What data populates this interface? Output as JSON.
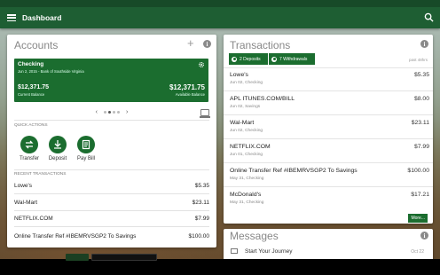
{
  "topbar": {
    "title": "Dashboard"
  },
  "accounts": {
    "title": "Accounts",
    "tile": {
      "name": "Checking",
      "subtitle": "Jun 2, 2015 - Bank of Southside Virginia",
      "current_balance": "$12,371.75",
      "current_label": "Current Balance",
      "available_balance": "$12,371.75",
      "available_label": "Available Balance"
    },
    "quick_actions_label": "QUICK ACTIONS",
    "quick_actions": [
      {
        "label": "Transfer",
        "icon": "transfer-icon"
      },
      {
        "label": "Deposit",
        "icon": "deposit-icon"
      },
      {
        "label": "Pay Bill",
        "icon": "pay-bill-icon"
      }
    ],
    "recent_label": "RECENT TRANSACTIONS",
    "recent": [
      {
        "name": "Lowe's",
        "amount": "$5.35"
      },
      {
        "name": "Wal-Mart",
        "amount": "$23.11"
      },
      {
        "name": "NETFLIX.COM",
        "amount": "$7.99"
      },
      {
        "name": "Online Transfer Ref #IBEMRVSGP2 To Savings",
        "amount": "$100.00"
      }
    ]
  },
  "transactions": {
    "title": "Transactions",
    "filter_deposits": "2 Deposits",
    "filter_withdrawals": "7 Withdrawals",
    "past_label": "past 48hrs",
    "items": [
      {
        "name": "Lowe's",
        "date": "Jun 02, Checking",
        "amount": "$5.35"
      },
      {
        "name": "APL ITUNES.COM/BILL",
        "date": "Jun 02, Savings",
        "amount": "$8.00"
      },
      {
        "name": "Wal-Mart",
        "date": "Jun 02, Checking",
        "amount": "$23.11"
      },
      {
        "name": "NETFLIX.COM",
        "date": "Jun 01, Checking",
        "amount": "$7.99"
      },
      {
        "name": "Online Transfer Ref #IBEMRVSGP2 To Savings",
        "date": "May 31, Checking",
        "amount": "$100.00"
      },
      {
        "name": "McDonald's",
        "date": "May 31, Checking",
        "amount": "$17.21"
      }
    ],
    "more_label": "More..."
  },
  "messages": {
    "title": "Messages",
    "items": [
      {
        "subject": "Start Your Journey",
        "date": "Oct 22"
      }
    ]
  },
  "colors": {
    "brand_green": "#1b6d2f",
    "topbar_green": "#1e5e33"
  }
}
